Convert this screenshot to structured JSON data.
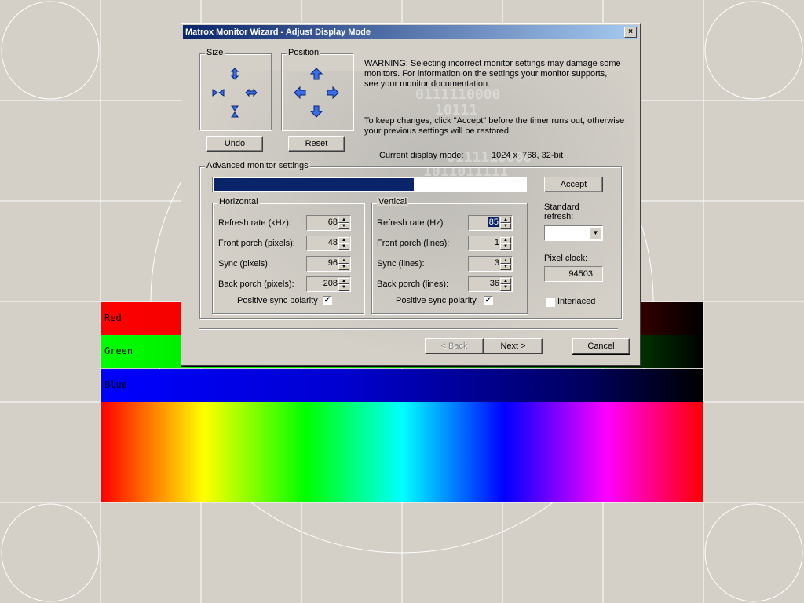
{
  "background": {
    "bars": [
      {
        "label": "Red",
        "color": "#ff0000"
      },
      {
        "label": "Green",
        "color": "#00ff00"
      },
      {
        "label": "Blue",
        "color": "#0000ff"
      }
    ]
  },
  "dialog": {
    "title": "Matrox Monitor Wizard - Adjust Display Mode",
    "close_label": "×",
    "size": {
      "label": "Size"
    },
    "position": {
      "label": "Position"
    },
    "undo_label": "Undo",
    "reset_label": "Reset",
    "warning": "WARNING: Selecting incorrect monitor settings may damage some monitors. For information on the settings your monitor supports, see your monitor documentation.",
    "keep_changes": "To keep changes, click \"Accept\" before the timer runs out, otherwise your previous settings will be restored.",
    "current_mode_label": "Current display mode:",
    "current_mode_value": "1024 x  768, 32-bit",
    "advanced_label": "Advanced monitor settings",
    "timer_progress": 0.64,
    "accept_label": "Accept",
    "horizontal": {
      "label": "Horizontal",
      "refresh_label": "Refresh rate (kHz):",
      "refresh_value": "68",
      "front_porch_label": "Front porch (pixels):",
      "front_porch_value": "48",
      "sync_label": "Sync (pixels):",
      "sync_value": "96",
      "back_porch_label": "Back porch (pixels):",
      "back_porch_value": "208",
      "polarity_label": "Positive sync polarity",
      "polarity_checked": true
    },
    "vertical": {
      "label": "Vertical",
      "refresh_label": "Refresh rate (Hz):",
      "refresh_value": "85",
      "front_porch_label": "Front porch (lines):",
      "front_porch_value": "1",
      "sync_label": "Sync (lines):",
      "sync_value": "3",
      "back_porch_label": "Back porch (lines):",
      "back_porch_value": "36",
      "polarity_label": "Positive sync polarity",
      "polarity_checked": true
    },
    "standard_refresh_label": "Standard refresh:",
    "standard_refresh_value": "",
    "pixel_clock_label": "Pixel clock:",
    "pixel_clock_value": "94503",
    "interlaced_label": "Interlaced",
    "interlaced_checked": false,
    "back_label": "< Back",
    "next_label": "Next >",
    "cancel_label": "Cancel",
    "watermark_lines": [
      "0111110000",
      "10111",
      "0111110000",
      "1011011111"
    ]
  }
}
